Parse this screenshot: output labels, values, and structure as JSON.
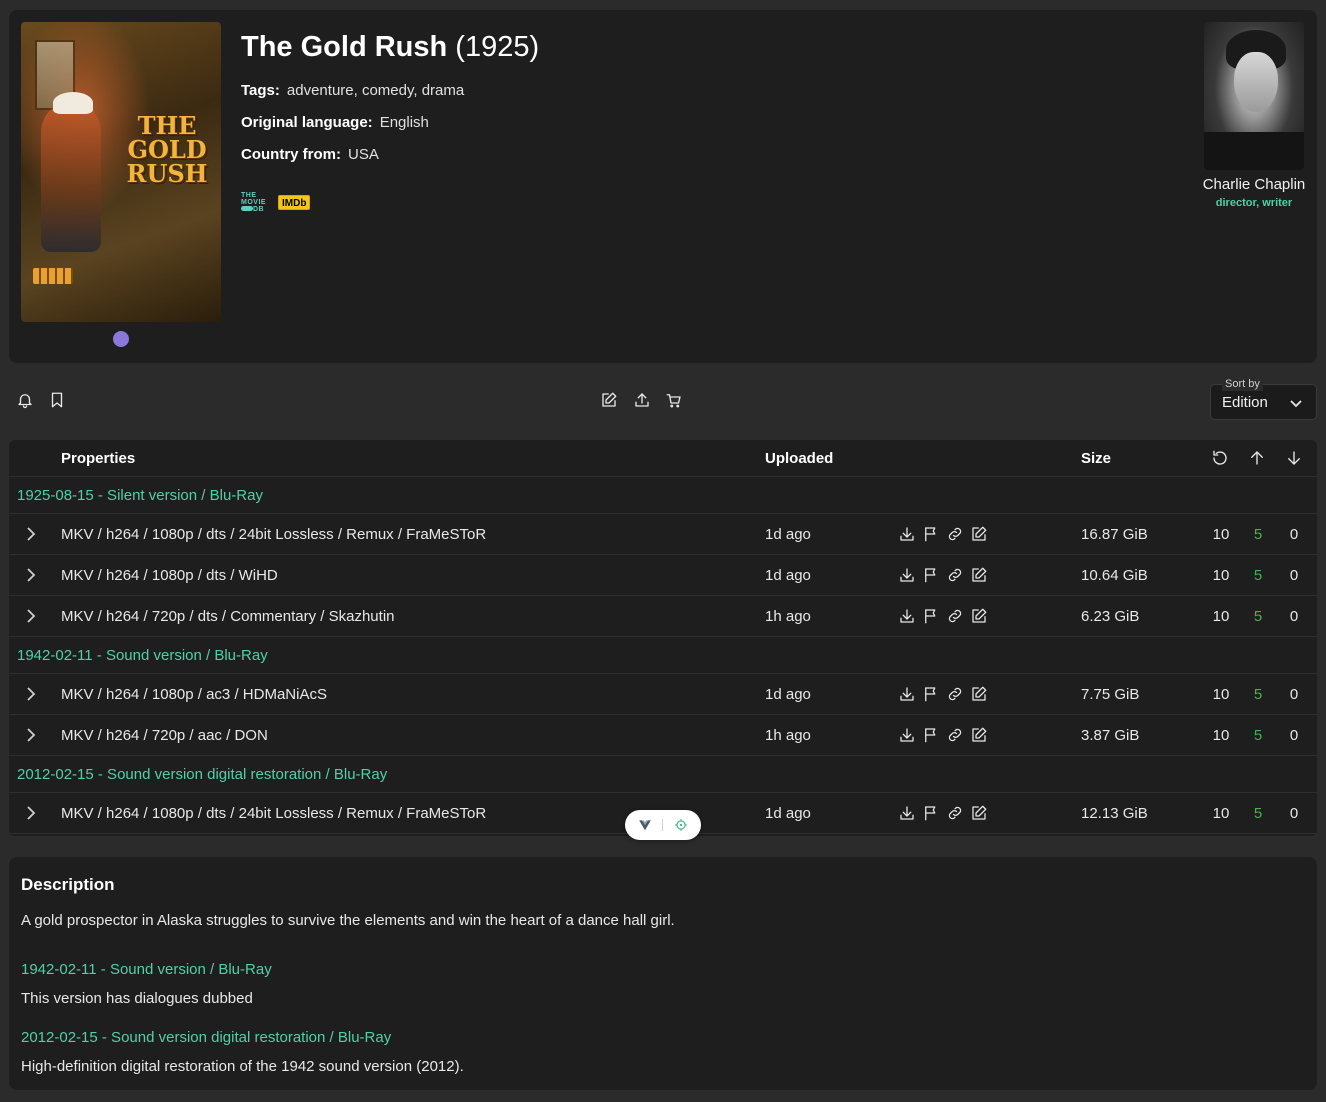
{
  "movie": {
    "title": "The Gold Rush",
    "year": "(1925)",
    "poster_text": "THE GOLD RUSH",
    "tags_label": "Tags:",
    "tags": "adventure, comedy, drama",
    "language_label": "Original language:",
    "language": "English",
    "country_label": "Country from:",
    "country": "USA",
    "tmdb_badge": [
      "THE",
      "MOVIE",
      "DB"
    ],
    "imdb_badge": "IMDb"
  },
  "person": {
    "name": "Charlie Chaplin",
    "roles": "director, writer"
  },
  "toolbar": {
    "sort_label": "Sort by",
    "sort_value": "Edition",
    "left_icons": [
      "bell-icon",
      "bookmark-icon"
    ],
    "center_icons": [
      "edit-icon",
      "upload-icon",
      "cart-icon"
    ]
  },
  "table": {
    "headers": {
      "properties": "Properties",
      "uploaded": "Uploaded",
      "size": "Size"
    },
    "header_icons": [
      "refresh-icon",
      "arrow-up-icon",
      "arrow-down-icon"
    ],
    "groups": [
      {
        "label": "1925-08-15 - Silent version / Blu-Ray",
        "rows": [
          {
            "props": "MKV / h264 / 1080p / dts / 24bit Lossless / Remux / FraMeSToR",
            "uploaded": "1d ago",
            "size": "16.87 GiB",
            "c1": "10",
            "c2": "5",
            "c3": "0"
          },
          {
            "props": "MKV / h264 / 1080p / dts / WiHD",
            "uploaded": "1d ago",
            "size": "10.64 GiB",
            "c1": "10",
            "c2": "5",
            "c3": "0"
          },
          {
            "props": "MKV / h264 / 720p / dts / Commentary / Skazhutin",
            "uploaded": "1h ago",
            "size": "6.23 GiB",
            "c1": "10",
            "c2": "5",
            "c3": "0"
          }
        ]
      },
      {
        "label": "1942-02-11 - Sound version / Blu-Ray",
        "rows": [
          {
            "props": "MKV / h264 / 1080p / ac3 / HDMaNiAcS",
            "uploaded": "1d ago",
            "size": "7.75 GiB",
            "c1": "10",
            "c2": "5",
            "c3": "0"
          },
          {
            "props": "MKV / h264 / 720p / aac / DON",
            "uploaded": "1h ago",
            "size": "3.87 GiB",
            "c1": "10",
            "c2": "5",
            "c3": "0"
          }
        ]
      },
      {
        "label": "2012-02-15 - Sound version digital restoration / Blu-Ray",
        "rows": [
          {
            "props": "MKV / h264 / 1080p / dts / 24bit Lossless / Remux / FraMeSToR",
            "uploaded": "1d ago",
            "size": "12.13 GiB",
            "c1": "10",
            "c2": "5",
            "c3": "0"
          }
        ]
      }
    ]
  },
  "description": {
    "heading": "Description",
    "text": "A gold prospector in Alaska struggles to survive the elements and win the heart of a dance hall girl.",
    "editions": [
      {
        "label": "1942-02-11 - Sound version / Blu-Ray",
        "text": "This version has dialogues dubbed"
      },
      {
        "label": "2012-02-15 - Sound version digital restoration / Blu-Ray",
        "text": "High-definition digital restoration of the 1942 sound version (2012)."
      }
    ]
  },
  "colors": {
    "accent": "#4fd0a8",
    "seeders": "#4caf50",
    "panel": "#1e1e1e",
    "background": "#2b2b2b",
    "carousel_dot": "#8b78d8",
    "imdb": "#f5c518"
  }
}
